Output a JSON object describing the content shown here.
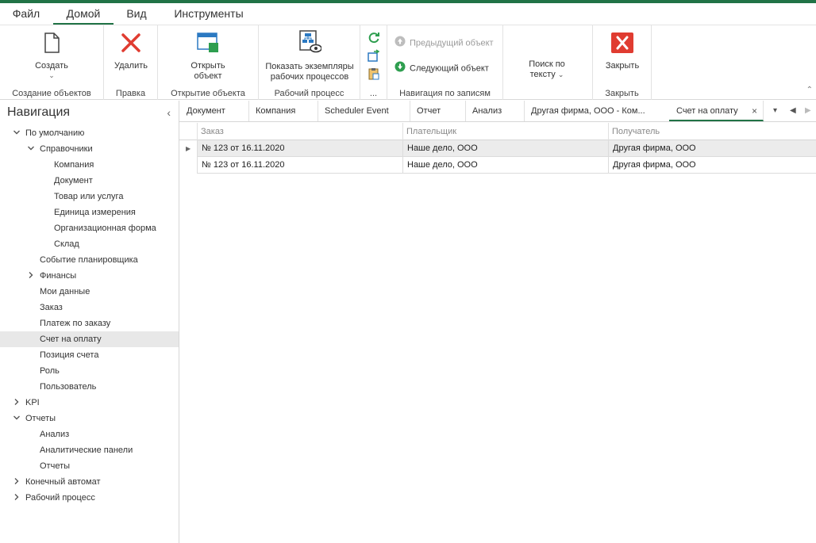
{
  "menu": {
    "tabs": [
      "Файл",
      "Домой",
      "Вид",
      "Инструменты"
    ]
  },
  "ribbon": {
    "create": {
      "button": "Создать",
      "group": "Создание объектов"
    },
    "edit": {
      "button": "Удалить",
      "group": "Правка"
    },
    "open": {
      "button_line1": "Открыть",
      "button_line2": "объект",
      "group": "Открытие объекта"
    },
    "workflow": {
      "button_line1": "Показать экземпляры",
      "button_line2": "рабочих процессов",
      "group": "Рабочий процесс"
    },
    "misc": {
      "group": "..."
    },
    "records": {
      "prev": "Предыдущий объект",
      "next": "Следующий объект",
      "group": "Навигация по записям"
    },
    "search": {
      "button_line1": "Поиск по",
      "button_line2": "тексту"
    },
    "close": {
      "button": "Закрыть",
      "group": "Закрыть"
    }
  },
  "navigation": {
    "title": "Навигация",
    "items": [
      {
        "label": "По умолчанию",
        "level": 0,
        "arrow": "down"
      },
      {
        "label": "Справочники",
        "level": 1,
        "arrow": "down"
      },
      {
        "label": "Компания",
        "level": 2
      },
      {
        "label": "Документ",
        "level": 2
      },
      {
        "label": "Товар или услуга",
        "level": 2
      },
      {
        "label": "Единица измерения",
        "level": 2
      },
      {
        "label": "Организационная форма",
        "level": 2
      },
      {
        "label": "Склад",
        "level": 2
      },
      {
        "label": "Событие планировщика",
        "level": 1
      },
      {
        "label": "Финансы",
        "level": 1,
        "arrow": "right"
      },
      {
        "label": "Мои данные",
        "level": 1
      },
      {
        "label": "Заказ",
        "level": 1
      },
      {
        "label": "Платеж по заказу",
        "level": 1
      },
      {
        "label": "Счет на оплату",
        "level": 1,
        "selected": true
      },
      {
        "label": "Позиция счета",
        "level": 1
      },
      {
        "label": "Роль",
        "level": 1
      },
      {
        "label": "Пользователь",
        "level": 1
      },
      {
        "label": "KPI",
        "level": 0,
        "arrow": "right"
      },
      {
        "label": "Отчеты",
        "level": 0,
        "arrow": "down"
      },
      {
        "label": "Анализ",
        "level": 1
      },
      {
        "label": "Аналитические панели",
        "level": 1
      },
      {
        "label": "Отчеты",
        "level": 1
      },
      {
        "label": "Конечный автомат",
        "level": 0,
        "arrow": "right"
      },
      {
        "label": "Рабочий процесс",
        "level": 0,
        "arrow": "right"
      }
    ]
  },
  "doc_tabs": {
    "items": [
      "Документ",
      "Компания",
      "Scheduler Event",
      "Отчет",
      "Анализ",
      "Другая фирма, ООО - Ком...",
      "Счет на оплату"
    ],
    "active_index": 6
  },
  "grid": {
    "columns": [
      "Заказ",
      "Плательщик",
      "Получатель"
    ],
    "rows": [
      [
        "№ 123 от 16.11.2020",
        "Наше дело, ООО",
        "Другая фирма, ООО"
      ],
      [
        "№ 123 от 16.11.2020",
        "Наше дело, ООО",
        "Другая фирма, ООО"
      ]
    ]
  },
  "colors": {
    "accent": "#217346",
    "delete_red": "#e03c31",
    "close_red": "#e03c31",
    "blue_icon": "#2b79c2",
    "green_icon": "#2e9e4f"
  },
  "icons": {
    "create": "new-document-icon",
    "delete": "delete-x-icon",
    "open": "open-window-icon",
    "workflow": "workflow-eye-icon",
    "refresh": "refresh-icon",
    "export": "export-icon",
    "clipboard": "clipboard-icon",
    "prev": "arrow-up-circle-icon",
    "next": "arrow-down-circle-icon",
    "close": "close-x-icon"
  }
}
